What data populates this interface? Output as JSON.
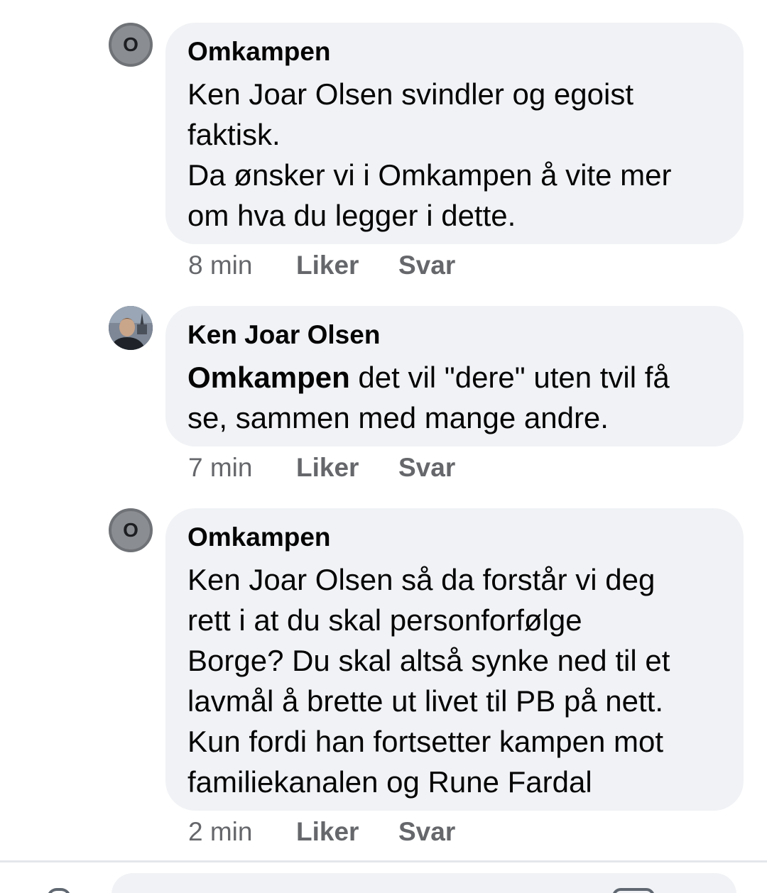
{
  "comments": [
    {
      "author": "Omkampen",
      "avatar_letter": "O",
      "text": "Ken Joar Olsen svindler og egoist\nfaktisk.\nDa ønsker vi i Omkampen å vite mer\nom hva du legger i dette.",
      "time": "8 min",
      "like_label": "Liker",
      "reply_label": "Svar"
    },
    {
      "author": "Ken Joar Olsen",
      "avatar_icon": "profile-photo",
      "mention": "Omkampen",
      "text": " det vil \"dere\" uten tvil få\nse, sammen med mange andre.",
      "time": "7 min",
      "like_label": "Liker",
      "reply_label": "Svar"
    },
    {
      "author": "Omkampen",
      "avatar_letter": "O",
      "text": "Ken Joar Olsen så da forstår vi deg\nrett i at du skal personforfølge\nBorge? Du skal altså synke ned til et\nlavmål å brette ut livet til PB på nett.\nKun fordi han fortsetter kampen mot\nfamiliekanalen og Rune Fardal",
      "time": "2 min",
      "like_label": "Liker",
      "reply_label": "Svar"
    }
  ],
  "colors": {
    "bubble": "#f0f2f5",
    "meta_text": "#65676b",
    "avatar_grey": "#8a8d91"
  }
}
